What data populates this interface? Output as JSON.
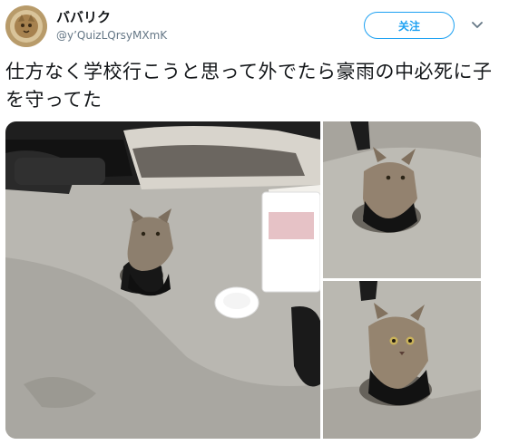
{
  "user": {
    "display_name": "ババリク",
    "handle": "@y’QuizLQrsyMXmK"
  },
  "follow_label": "关注",
  "menu_icon": "chevron-down-icon",
  "tweet_text": "仕方なく学校行こうと思って外でたら豪雨の中必死に子を守ってた",
  "colors": {
    "accent": "#1da1f2",
    "text": "#14171a",
    "muted": "#657786"
  },
  "media": {
    "photo_count": 3
  }
}
